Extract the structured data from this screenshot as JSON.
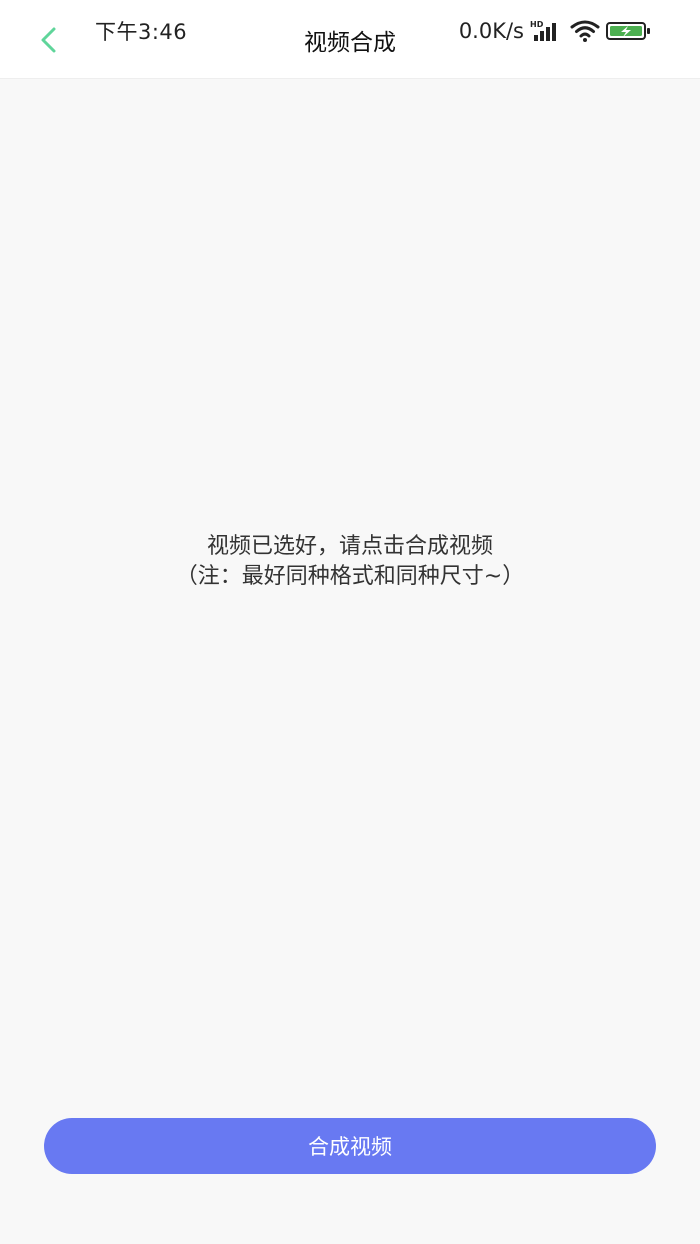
{
  "status_bar": {
    "time": "下午3:46",
    "net_speed": "0.0K/s",
    "signal_badge": "HD"
  },
  "header": {
    "title": "视频合成"
  },
  "main": {
    "message_line1": "视频已选好，请点击合成视频",
    "message_line2": "（注：最好同种格式和同种尺寸~）"
  },
  "action": {
    "label": "合成视频"
  },
  "colors": {
    "accent": "#6879f2",
    "back_icon": "#5fd59a",
    "battery": "#4caf50",
    "background": "#f8f8f8"
  },
  "icons": {
    "back": "chevron-left-icon",
    "signal": "signal-icon",
    "wifi": "wifi-icon",
    "battery": "battery-charging-icon"
  }
}
